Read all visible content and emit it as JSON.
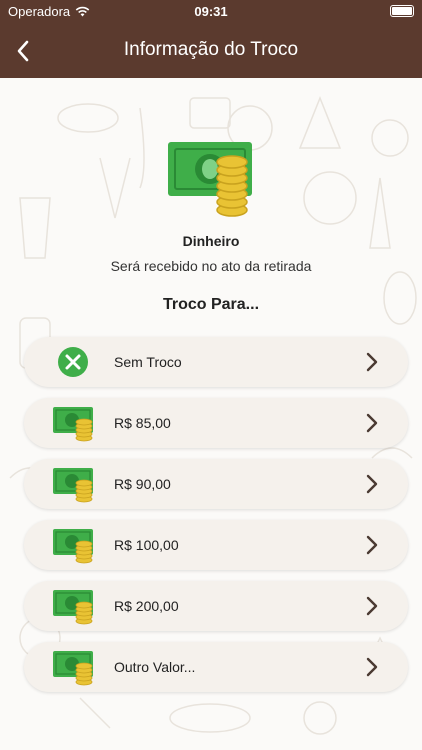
{
  "status_bar": {
    "carrier": "Operadora",
    "time": "09:31"
  },
  "nav": {
    "title": "Informação do Troco"
  },
  "payment": {
    "method": "Dinheiro",
    "subtitle": "Será recebido no ato da retirada"
  },
  "change_section": {
    "title": "Troco Para..."
  },
  "options": [
    {
      "label": "Sem Troco",
      "icon": "no-change-icon"
    },
    {
      "label": "R$ 85,00",
      "icon": "cash-coins-icon"
    },
    {
      "label": "R$ 90,00",
      "icon": "cash-coins-icon"
    },
    {
      "label": "R$ 100,00",
      "icon": "cash-coins-icon"
    },
    {
      "label": "R$ 200,00",
      "icon": "cash-coins-icon"
    },
    {
      "label": "Outro Valor...",
      "icon": "cash-coins-icon"
    }
  ],
  "colors": {
    "header": "#5b3a2e",
    "accent_green": "#3fae49",
    "coin": "#e9c334",
    "option_bg": "#f5f1ec"
  }
}
